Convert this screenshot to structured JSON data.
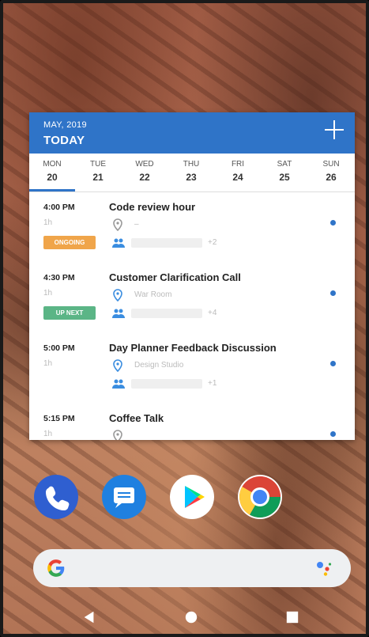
{
  "widget": {
    "month": "MAY, 2019",
    "today_label": "TODAY",
    "add_icon": "plus-icon",
    "days": [
      {
        "name": "MON",
        "num": "20"
      },
      {
        "name": "TUE",
        "num": "21"
      },
      {
        "name": "WED",
        "num": "22"
      },
      {
        "name": "THU",
        "num": "23"
      },
      {
        "name": "FRI",
        "num": "24"
      },
      {
        "name": "SAT",
        "num": "25"
      },
      {
        "name": "SUN",
        "num": "26"
      }
    ],
    "events": [
      {
        "time": "4:00 PM",
        "duration": "1h",
        "badge": "ONGOING",
        "title": "Code review hour",
        "location": "–",
        "attendees_extra": "+2"
      },
      {
        "time": "4:30 PM",
        "duration": "1h",
        "badge": "UP NEXT",
        "title": "Customer Clarification Call",
        "location": "War Room",
        "attendees_extra": "+4"
      },
      {
        "time": "5:00 PM",
        "duration": "1h",
        "badge": "",
        "title": "Day Planner Feedback Discussion",
        "location": "Design Studio",
        "attendees_extra": "+1"
      },
      {
        "time": "5:15 PM",
        "duration": "1h",
        "badge": "",
        "title": "Coffee Talk",
        "location": "",
        "attendees_extra": ""
      }
    ]
  },
  "dock": [
    "phone-icon",
    "messages-icon",
    "play-store-icon",
    "chrome-icon"
  ],
  "search": {
    "google_icon": "google-icon",
    "assistant_icon": "assistant-icon"
  },
  "nav": [
    "back-icon",
    "home-icon",
    "recents-icon"
  ],
  "colors": {
    "accent": "#2f74c8",
    "ongoing": "#f0a54a",
    "upnext": "#5bb586"
  }
}
